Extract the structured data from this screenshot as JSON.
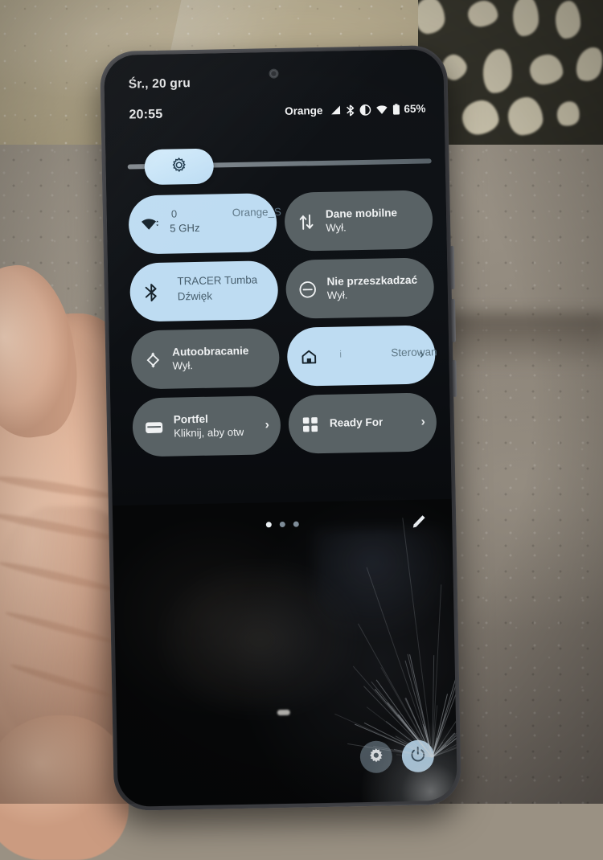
{
  "status_bar": {
    "date": "Śr., 20 gru",
    "time": "20:55",
    "carrier": "Orange",
    "battery_percent": "65%",
    "icons": [
      "signal-icon",
      "bluetooth-icon",
      "do-not-disturb-icon",
      "wifi-icon",
      "battery-icon"
    ]
  },
  "brightness": {
    "icon": "brightness-icon",
    "level_percent": 21
  },
  "tiles": [
    {
      "name": "wifi",
      "icon": "wifi-icon",
      "state": "on",
      "line1": "0",
      "line2": "5 GHz",
      "ssid": "Orange_S",
      "chevron": ""
    },
    {
      "name": "mobile-data",
      "icon": "data-transfer-icon",
      "state": "off",
      "line1": "Dane mobilne",
      "line2": "Wył.",
      "chevron": ""
    },
    {
      "name": "bluetooth",
      "icon": "bluetooth-icon",
      "state": "on",
      "line1": "TRACER Tumba",
      "line2": "Dźwięk",
      "chevron": ""
    },
    {
      "name": "do-not-disturb",
      "icon": "do-not-disturb-icon",
      "state": "off",
      "line1": "Nie przeszkadzać",
      "line2": "Wył.",
      "chevron": ""
    },
    {
      "name": "auto-rotate",
      "icon": "auto-rotate-icon",
      "state": "off",
      "line1": "Autoobracanie",
      "line2": "Wył.",
      "chevron": ""
    },
    {
      "name": "device-controls",
      "icon": "home-icon",
      "state": "on",
      "line1": "Sterowan",
      "line2": "",
      "info_mark": "i",
      "chevron": "›"
    },
    {
      "name": "wallet",
      "icon": "wallet-icon",
      "state": "off",
      "line1": "Portfel",
      "line2": "Kliknij, aby otw",
      "chevron": "›"
    },
    {
      "name": "ready-for",
      "icon": "grid-icon",
      "state": "off",
      "line1": "Ready For",
      "line2": "",
      "chevron": "›"
    }
  ],
  "pager": {
    "total_pages": 3,
    "active_page": 1
  },
  "edit_button": {
    "icon": "pencil-icon"
  },
  "bottom_buttons": [
    {
      "name": "settings",
      "icon": "gear-icon",
      "state": "dark"
    },
    {
      "name": "power",
      "icon": "power-icon",
      "state": "light"
    }
  ],
  "colors": {
    "tile_on": "#bedcf2",
    "tile_off": "#596265",
    "panel_bg": "#101317",
    "text_light": "#f0f2f3",
    "text_dark": "#37474f"
  }
}
